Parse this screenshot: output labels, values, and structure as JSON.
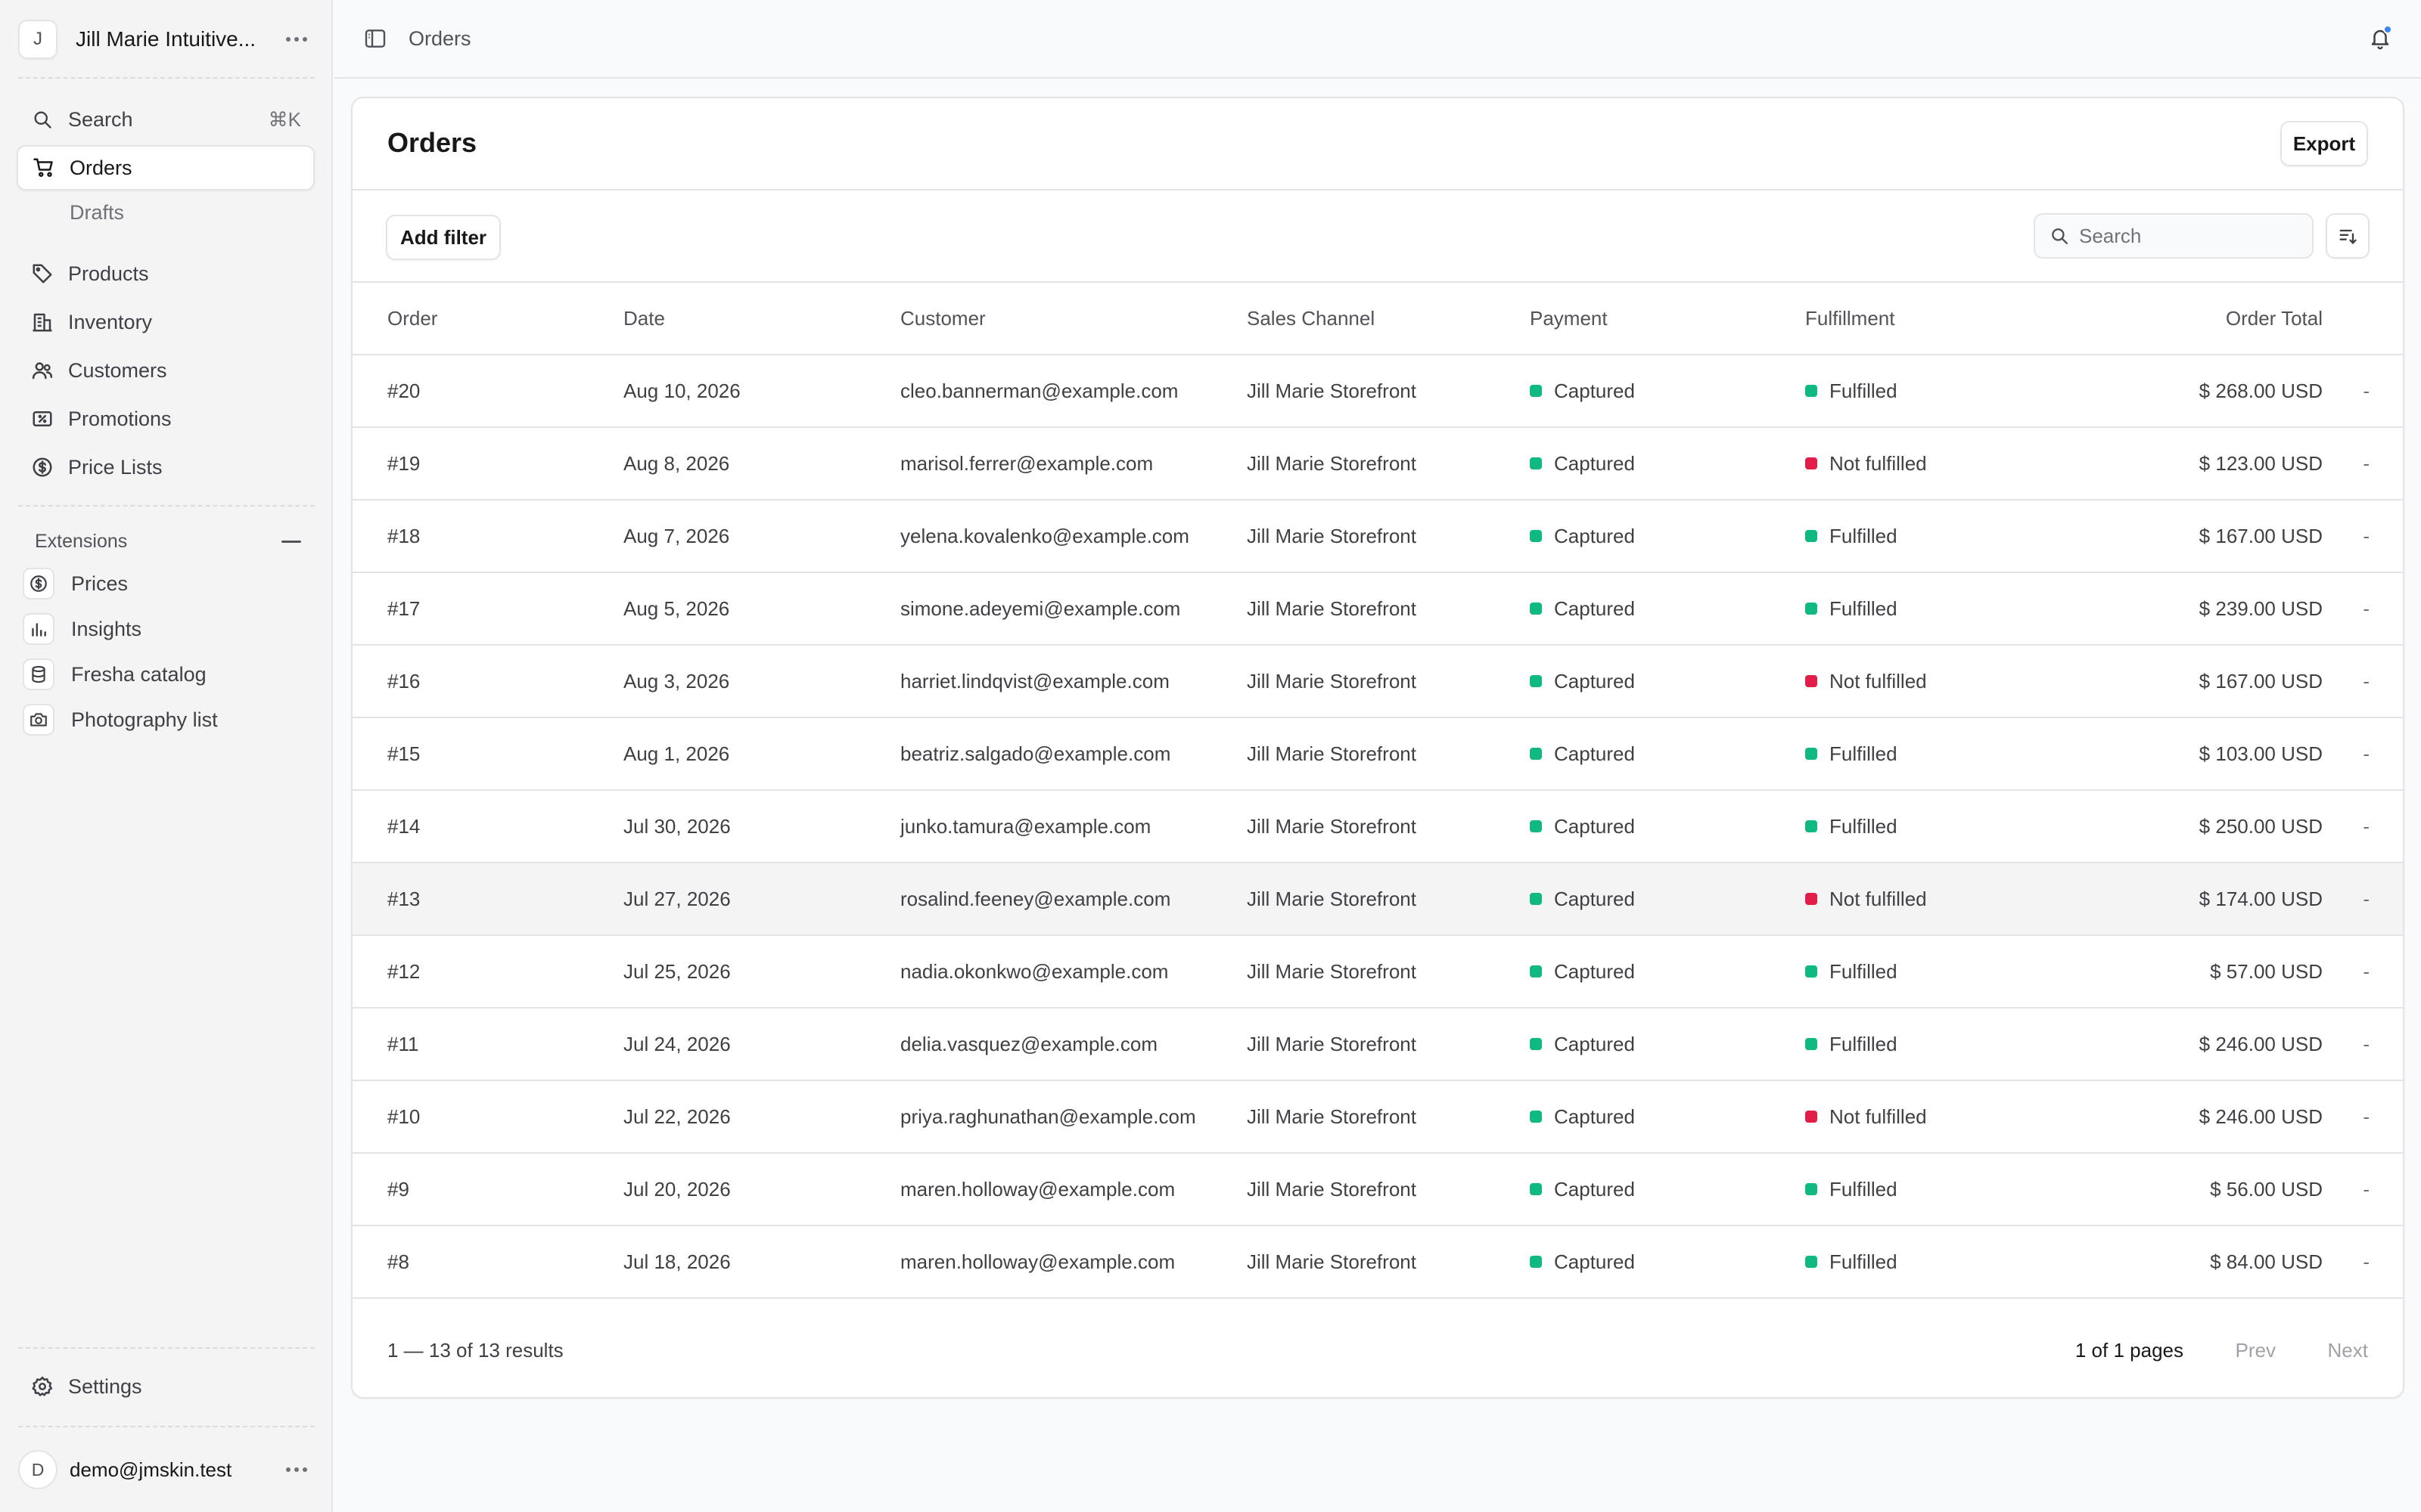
{
  "sidebar": {
    "store_initial": "J",
    "store_name": "Jill Marie Intuitive...",
    "search_label": "Search",
    "search_shortcut": "⌘K",
    "nav": {
      "orders": "Orders",
      "drafts": "Drafts",
      "products": "Products",
      "inventory": "Inventory",
      "customers": "Customers",
      "promotions": "Promotions",
      "price_lists": "Price Lists"
    },
    "extensions_title": "Extensions",
    "extensions": {
      "prices": "Prices",
      "insights": "Insights",
      "fresha_catalog": "Fresha catalog",
      "photography_list": "Photography list"
    },
    "settings": "Settings",
    "user_initial": "D",
    "user_email": "demo@jmskin.test"
  },
  "topbar": {
    "breadcrumb": "Orders"
  },
  "main": {
    "title": "Orders",
    "export_label": "Export",
    "add_filter_label": "Add filter",
    "search_placeholder": "Search",
    "columns": {
      "order": "Order",
      "date": "Date",
      "customer": "Customer",
      "channel": "Sales Channel",
      "payment": "Payment",
      "fulfillment": "Fulfillment",
      "total": "Order Total"
    },
    "rows": [
      {
        "order": "#20",
        "date": "Aug 10, 2026",
        "customer": "cleo.bannerman@example.com",
        "channel": "Jill Marie Storefront",
        "payment": "Captured",
        "fulfillment": "Fulfilled",
        "total": "$ 268.00 USD",
        "extra": "-"
      },
      {
        "order": "#19",
        "date": "Aug 8, 2026",
        "customer": "marisol.ferrer@example.com",
        "channel": "Jill Marie Storefront",
        "payment": "Captured",
        "fulfillment": "Not fulfilled",
        "total": "$ 123.00 USD",
        "extra": "-"
      },
      {
        "order": "#18",
        "date": "Aug 7, 2026",
        "customer": "yelena.kovalenko@example.com",
        "channel": "Jill Marie Storefront",
        "payment": "Captured",
        "fulfillment": "Fulfilled",
        "total": "$ 167.00 USD",
        "extra": "-"
      },
      {
        "order": "#17",
        "date": "Aug 5, 2026",
        "customer": "simone.adeyemi@example.com",
        "channel": "Jill Marie Storefront",
        "payment": "Captured",
        "fulfillment": "Fulfilled",
        "total": "$ 239.00 USD",
        "extra": "-"
      },
      {
        "order": "#16",
        "date": "Aug 3, 2026",
        "customer": "harriet.lindqvist@example.com",
        "channel": "Jill Marie Storefront",
        "payment": "Captured",
        "fulfillment": "Not fulfilled",
        "total": "$ 167.00 USD",
        "extra": "-"
      },
      {
        "order": "#15",
        "date": "Aug 1, 2026",
        "customer": "beatriz.salgado@example.com",
        "channel": "Jill Marie Storefront",
        "payment": "Captured",
        "fulfillment": "Fulfilled",
        "total": "$ 103.00 USD",
        "extra": "-"
      },
      {
        "order": "#14",
        "date": "Jul 30, 2026",
        "customer": "junko.tamura@example.com",
        "channel": "Jill Marie Storefront",
        "payment": "Captured",
        "fulfillment": "Fulfilled",
        "total": "$ 250.00 USD",
        "extra": "-"
      },
      {
        "order": "#13",
        "date": "Jul 27, 2026",
        "customer": "rosalind.feeney@example.com",
        "channel": "Jill Marie Storefront",
        "payment": "Captured",
        "fulfillment": "Not fulfilled",
        "total": "$ 174.00 USD",
        "extra": "-"
      },
      {
        "order": "#12",
        "date": "Jul 25, 2026",
        "customer": "nadia.okonkwo@example.com",
        "channel": "Jill Marie Storefront",
        "payment": "Captured",
        "fulfillment": "Fulfilled",
        "total": "$ 57.00 USD",
        "extra": "-"
      },
      {
        "order": "#11",
        "date": "Jul 24, 2026",
        "customer": "delia.vasquez@example.com",
        "channel": "Jill Marie Storefront",
        "payment": "Captured",
        "fulfillment": "Fulfilled",
        "total": "$ 246.00 USD",
        "extra": "-"
      },
      {
        "order": "#10",
        "date": "Jul 22, 2026",
        "customer": "priya.raghunathan@example.com",
        "channel": "Jill Marie Storefront",
        "payment": "Captured",
        "fulfillment": "Not fulfilled",
        "total": "$ 246.00 USD",
        "extra": "-"
      },
      {
        "order": "#9",
        "date": "Jul 20, 2026",
        "customer": "maren.holloway@example.com",
        "channel": "Jill Marie Storefront",
        "payment": "Captured",
        "fulfillment": "Fulfilled",
        "total": "$ 56.00 USD",
        "extra": "-"
      },
      {
        "order": "#8",
        "date": "Jul 18, 2026",
        "customer": "maren.holloway@example.com",
        "channel": "Jill Marie Storefront",
        "payment": "Captured",
        "fulfillment": "Fulfilled",
        "total": "$ 84.00 USD",
        "extra": "-"
      }
    ],
    "highlighted_row": "#13",
    "pagination": {
      "results": "1 — 13 of 13 results",
      "pages": "1 of 1 pages",
      "prev": "Prev",
      "next": "Next"
    }
  },
  "colors": {
    "status_green": "#10b981",
    "status_red": "#e11d48",
    "notification_dot": "#3b82f6"
  },
  "icons": {
    "search": "search-icon",
    "orders": "shopping-cart-icon",
    "products": "tag-icon",
    "inventory": "building-icon",
    "customers": "users-icon",
    "promotions": "receipt-percent-icon",
    "price_lists": "currency-dollar-icon",
    "settings": "gear-icon",
    "sidebar_toggle": "sidebar-toggle-icon",
    "notifications": "bell-icon",
    "sort": "sort-descending-icon"
  }
}
